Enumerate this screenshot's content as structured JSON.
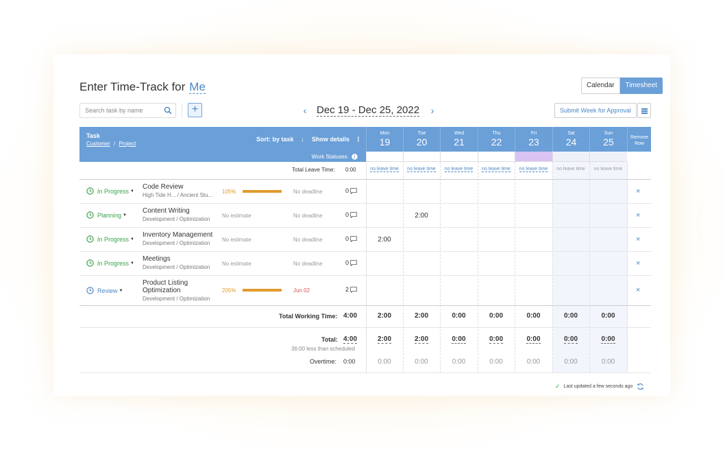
{
  "header": {
    "title": "Enter Time-Track for",
    "who": "Me",
    "view_calendar": "Calendar",
    "view_timesheet": "Timesheet"
  },
  "toolbar": {
    "search_placeholder": "Search task by name",
    "add_label": "+",
    "week_range": "Dec 19 - Dec 25, 2022",
    "prev_arrow": "‹",
    "next_arrow": "›",
    "submit_label": "Submit Week for Approval"
  },
  "table_header": {
    "task": "Task",
    "customer": "Customer",
    "separator": "/",
    "project": "Project",
    "sort": "Sort: by task",
    "sort_arrow": "↓",
    "show_details": "Show details",
    "details_dots": "⋮",
    "work_statuses": "Work Statuses:",
    "remove_row": "Remove Row",
    "days": [
      {
        "name": "Mon",
        "date": "19"
      },
      {
        "name": "Tue",
        "date": "20"
      },
      {
        "name": "Wed",
        "date": "21"
      },
      {
        "name": "Thu",
        "date": "22"
      },
      {
        "name": "Fri",
        "date": "23"
      },
      {
        "name": "Sat",
        "date": "24"
      },
      {
        "name": "Sun",
        "date": "25"
      }
    ]
  },
  "leave": {
    "label": "Total Leave Time:",
    "value": "0:00",
    "days": [
      "no leave time",
      "no leave time",
      "no leave time",
      "no leave time",
      "no leave time",
      "no leave time",
      "no leave time"
    ]
  },
  "rows": [
    {
      "status": "In Progress",
      "task": "Code Review",
      "task2": "",
      "sub": "High Tide H... / Ancient Stu...",
      "estimate": "105%",
      "progress": 1.0,
      "deadline": "No deadline",
      "comments": "0",
      "hours": [
        "",
        "",
        "",
        "",
        "",
        "",
        ""
      ]
    },
    {
      "status": "Planning",
      "task": "Content Writing",
      "task2": "",
      "sub": "Development / Optimization",
      "estimate": "No estimate",
      "progress": null,
      "deadline": "No deadline",
      "comments": "0",
      "hours": [
        "",
        "2:00",
        "",
        "",
        "",
        "",
        ""
      ]
    },
    {
      "status": "In Progress",
      "task": "Inventory Management",
      "task2": "",
      "sub": "Development / Optimization",
      "estimate": "No estimate",
      "progress": null,
      "deadline": "No deadline",
      "comments": "0",
      "hours": [
        "2:00",
        "",
        "",
        "",
        "",
        "",
        ""
      ]
    },
    {
      "status": "In Progress",
      "task": "Meetings",
      "task2": "",
      "sub": "Development / Optimization",
      "estimate": "No estimate",
      "progress": null,
      "deadline": "No deadline",
      "comments": "0",
      "hours": [
        "",
        "",
        "",
        "",
        "",
        "",
        ""
      ]
    },
    {
      "status": "Review",
      "task": "Product Listing",
      "task2": "Optimization",
      "sub": "Development / Optimization",
      "estimate": "205%",
      "progress": 1.0,
      "deadline": "Jun 02",
      "comments": "2",
      "hours": [
        "",
        "",
        "",
        "",
        "",
        "",
        ""
      ]
    }
  ],
  "remove_symbol": "×",
  "totals": {
    "working_label": "Total Working Time:",
    "working_value": "4:00",
    "working_days": [
      "2:00",
      "2:00",
      "0:00",
      "0:00",
      "0:00",
      "0:00",
      "0:00"
    ],
    "total_label": "Total:",
    "total_value": "4:00",
    "total_note": "36:00 less than scheduled",
    "total_days": [
      "2:00",
      "2:00",
      "0:00",
      "0:00",
      "0:00",
      "0:00",
      "0:00"
    ],
    "overtime_label": "Overtime:",
    "overtime_value": "0:00",
    "overtime_days": [
      "0:00",
      "0:00",
      "0:00",
      "0:00",
      "0:00",
      "0:00",
      "0:00"
    ]
  },
  "footer": {
    "check": "✓",
    "updated": "Last updated a few seconds ago"
  },
  "colors": {
    "accent": "#4a86c5",
    "header_blue": "#6a9fd8",
    "status_green": "#3aa04a",
    "progress_orange": "#e09a2d",
    "deadline_red": "#d9534f",
    "friday_status": "#d9c3f3"
  }
}
